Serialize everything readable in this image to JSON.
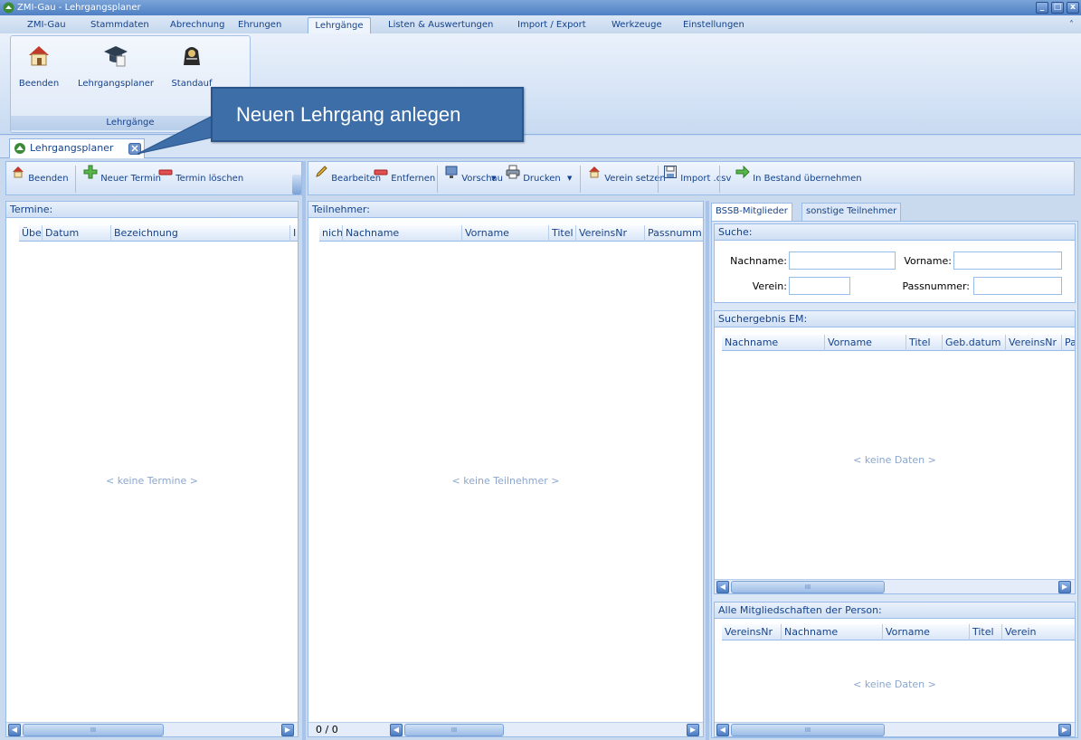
{
  "window": {
    "title": "ZMI-Gau - Lehrgangsplaner",
    "buttons": {
      "minimize": "_",
      "maximize": "□",
      "close": "x"
    }
  },
  "menu": {
    "tabs": [
      {
        "label": "ZMI-Gau"
      },
      {
        "label": "Stammdaten"
      },
      {
        "label": "Abrechnung"
      },
      {
        "label": "Ehrungen"
      },
      {
        "label": "Lehrgänge",
        "active": true
      },
      {
        "label": "Listen & Auswertungen"
      },
      {
        "label": "Import / Export"
      },
      {
        "label": "Werkzeuge"
      },
      {
        "label": "Einstellungen"
      }
    ],
    "collapse_glyph": "˄"
  },
  "ribbon": {
    "group_label": "Lehrgänge",
    "buttons": [
      {
        "label": "Beenden",
        "icon": "house-icon"
      },
      {
        "label": "Lehrgangsplaner",
        "icon": "graduation-cap-icon"
      },
      {
        "label": "Standauf",
        "icon": "standauf-icon"
      }
    ]
  },
  "callout": {
    "text": "Neuen Lehrgang anlegen"
  },
  "doc_tab": {
    "label": "Lehrgangsplaner"
  },
  "left_panel": {
    "toolbar": {
      "beenden": "Beenden",
      "neuer_termin": "Neuer Termin",
      "termin_loeschen": "Termin löschen"
    },
    "header": "Termine:",
    "columns": [
      "Übe",
      "Datum",
      "Bezeichnung",
      "I"
    ],
    "empty": "< keine Termine >",
    "scroll_thumb": "III"
  },
  "middle_panel": {
    "toolbar": {
      "bearbeiten": "Bearbeiten",
      "entfernen": "Entfernen",
      "vorschau": "Vorschau",
      "drucken": "Drucken",
      "verein_setzen": "Verein setzen",
      "import_csv": "Import .csv",
      "bestand": "In Bestand übernehmen"
    },
    "header": "Teilnehmer:",
    "columns": [
      "nich",
      "Nachname",
      "Vorname",
      "Titel",
      "VereinsNr",
      "Passnumm"
    ],
    "empty": "< keine Teilnehmer >",
    "count": "0 / 0",
    "scroll_thumb": "III"
  },
  "right_panel": {
    "tabs": [
      {
        "label": "BSSB-Mitglieder",
        "active": true
      },
      {
        "label": "sonstige Teilnehmer"
      }
    ],
    "search": {
      "header": "Suche:",
      "nachname_label": "Nachname:",
      "vorname_label": "Vorname:",
      "verein_label": "Verein:",
      "passnummer_label": "Passnummer:",
      "nachname_value": "",
      "vorname_value": "",
      "verein_value": "",
      "passnummer_value": ""
    },
    "results": {
      "header": "Suchergebnis EM:",
      "columns": [
        "Nachname",
        "Vorname",
        "Titel",
        "Geb.datum",
        "VereinsNr",
        "Pa"
      ],
      "empty": "< keine Daten >",
      "scroll_thumb": "III"
    },
    "memberships": {
      "header": "Alle Mitgliedschaften der Person:",
      "columns": [
        "VereinsNr",
        "Nachname",
        "Vorname",
        "Titel",
        "Verein"
      ],
      "empty": "< keine Daten >",
      "scroll_thumb": "III"
    }
  },
  "colors": {
    "accent": "#15428b",
    "panel_border": "#99bbe8",
    "callout": "#3d6ea8",
    "empty_text": "#8aa6cf"
  }
}
